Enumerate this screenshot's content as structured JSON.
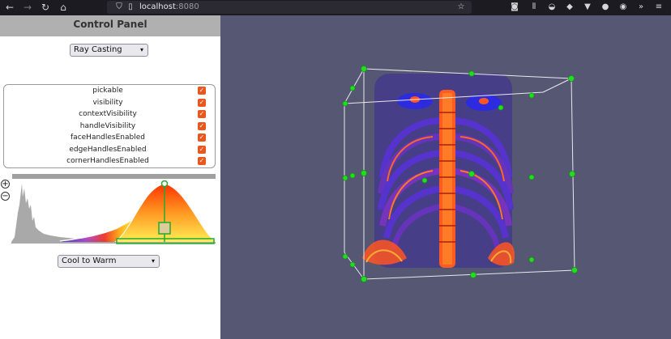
{
  "browser": {
    "url_host": "localhost",
    "url_port": ":8080",
    "back_icon": "back-arrow-icon",
    "forward_icon": "forward-arrow-icon",
    "reload_icon": "reload-icon",
    "home_icon": "home-icon"
  },
  "panel": {
    "title": "Control Panel",
    "mode_select": "Ray Casting",
    "properties": [
      {
        "label": "pickable",
        "checked": true
      },
      {
        "label": "visibility",
        "checked": true
      },
      {
        "label": "contextVisibility",
        "checked": true
      },
      {
        "label": "handleVisibility",
        "checked": true
      },
      {
        "label": "faceHandlesEnabled",
        "checked": true
      },
      {
        "label": "edgeHandlesEnabled",
        "checked": true
      },
      {
        "label": "cornerHandlesEnabled",
        "checked": true
      }
    ],
    "check_mark": "✓",
    "zoom_in": "+",
    "zoom_out": "−",
    "colormap_select": "Cool to Warm"
  },
  "colors": {
    "viewport_bg": "#565772",
    "accent_checkbox": "#e8571e",
    "handle_green": "#22dd22"
  }
}
